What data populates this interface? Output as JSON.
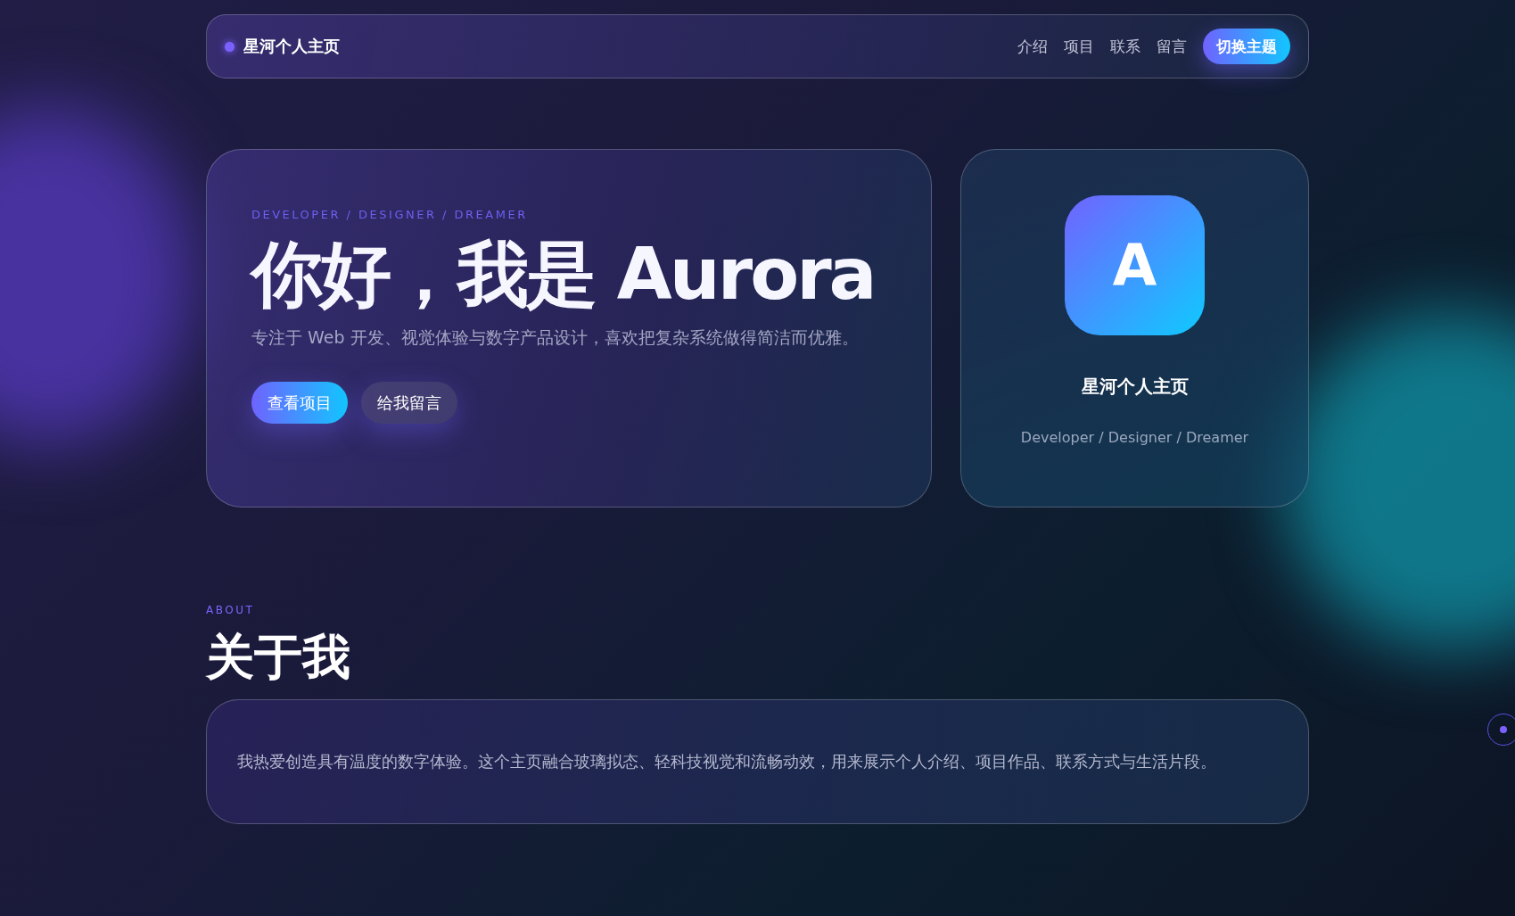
{
  "navbar": {
    "brand": "星河个人主页",
    "links": [
      {
        "label": "介绍"
      },
      {
        "label": "项目"
      },
      {
        "label": "联系"
      },
      {
        "label": "留言"
      }
    ],
    "theme_button": "切换主题"
  },
  "hero": {
    "eyebrow": "DEVELOPER / DESIGNER / DREAMER",
    "title": "你好，我是 Aurora",
    "subtitle": "专注于 Web 开发、视觉体验与数字产品设计，喜欢把复杂系统做得简洁而优雅。",
    "buttons": [
      {
        "label": "查看项目",
        "kind": "primary"
      },
      {
        "label": "给我留言",
        "kind": "secondary"
      }
    ]
  },
  "profile": {
    "avatar_letter": "A",
    "name": "星河个人主页",
    "tagline": "Developer / Designer / Dreamer"
  },
  "about": {
    "eyebrow": "ABOUT",
    "heading": "关于我",
    "text": "我热爱创造具有温度的数字体验。这个主页融合玻璃拟态、轻科技视觉和流畅动效，用来展示个人介绍、项目作品、联系方式与生活片段。"
  }
}
